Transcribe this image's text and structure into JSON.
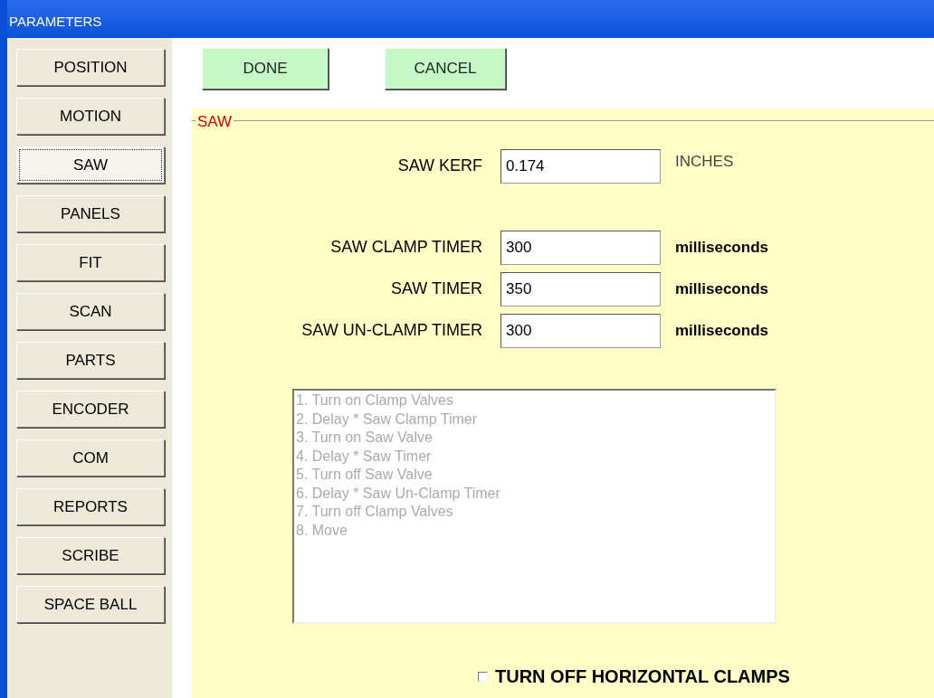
{
  "window": {
    "title": "PARAMETERS"
  },
  "sidebar": {
    "items": [
      {
        "label": "POSITION",
        "selected": false
      },
      {
        "label": "MOTION",
        "selected": false
      },
      {
        "label": "SAW",
        "selected": true
      },
      {
        "label": "PANELS",
        "selected": false
      },
      {
        "label": "FIT",
        "selected": false
      },
      {
        "label": "SCAN",
        "selected": false
      },
      {
        "label": "PARTS",
        "selected": false
      },
      {
        "label": "ENCODER",
        "selected": false
      },
      {
        "label": "COM",
        "selected": false
      },
      {
        "label": "REPORTS",
        "selected": false
      },
      {
        "label": "SCRIBE",
        "selected": false
      },
      {
        "label": "SPACE BALL",
        "selected": false
      }
    ]
  },
  "buttons": [
    "DONE",
    "CANCEL"
  ],
  "group": {
    "title": "SAW",
    "fields": [
      {
        "label": "SAW KERF",
        "value": "0.174",
        "unit": "INCHES",
        "kind": "plain"
      },
      {
        "label": "SAW CLAMP TIMER",
        "value": "300",
        "unit": "milliseconds",
        "kind": "bold"
      },
      {
        "label": "SAW TIMER",
        "value": "350",
        "unit": "milliseconds",
        "kind": "bold"
      },
      {
        "label": "SAW UN-CLAMP TIMER",
        "value": "300",
        "unit": "milliseconds",
        "kind": "bold"
      }
    ],
    "sequence": [
      "1. Turn on Clamp Valves",
      "2. Delay * Saw Clamp Timer",
      "3. Turn on Saw Valve",
      "4. Delay * Saw Timer",
      "5. Turn off Saw Valve",
      "6. Delay * Saw Un-Clamp Timer",
      "7. Turn off Clamp Valves",
      "8. Move"
    ],
    "checkbox": {
      "label": "TURN OFF HORIZONTAL CLAMPS",
      "checked": false
    }
  }
}
